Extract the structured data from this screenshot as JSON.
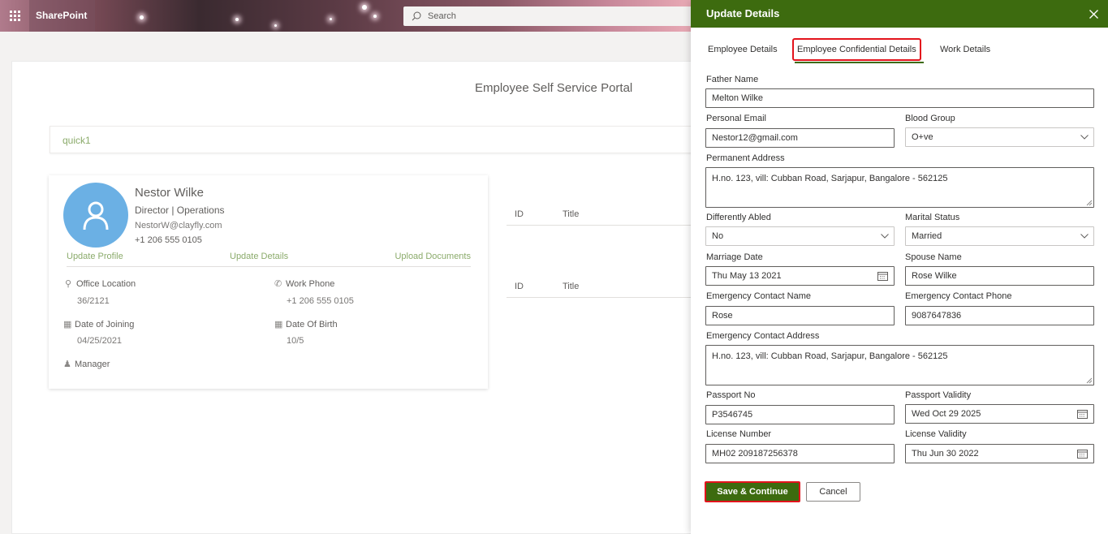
{
  "suite": {
    "brand": "SharePoint",
    "search_placeholder": "Search"
  },
  "page": {
    "title": "Employee Self Service Portal",
    "quick_links": "quick1"
  },
  "profile": {
    "name": "Nestor Wilke",
    "role": "Director | Operations",
    "email": "NestorW@clayfly.com",
    "phone": "+1 206 555 0105",
    "links": {
      "update_profile": "Update Profile",
      "update_details": "Update Details",
      "upload_documents": "Upload Documents"
    },
    "office_location_label": "Office Location",
    "office_location": "36/2121",
    "work_phone_label": "Work Phone",
    "work_phone": "+1 206 555 0105",
    "date_of_joining_label": "Date of Joining",
    "date_of_joining": "04/25/2021",
    "date_of_birth_label": "Date Of Birth",
    "date_of_birth": "10/5",
    "manager_label": "Manager"
  },
  "tables": [
    {
      "col_id": "ID",
      "col_title": "Title"
    },
    {
      "col_id": "ID",
      "col_title": "Title"
    }
  ],
  "panel": {
    "title": "Update Details",
    "tabs": [
      "Employee Details",
      "Employee Confidential Details",
      "Work Details"
    ],
    "active_tab": "Employee Confidential Details",
    "fields": {
      "father_name": {
        "label": "Father Name",
        "value": "Melton Wilke"
      },
      "personal_email": {
        "label": "Personal Email",
        "value": "Nestor12@gmail.com"
      },
      "blood_group": {
        "label": "Blood Group",
        "value": "O+ve"
      },
      "permanent_address": {
        "label": "Permanent Address",
        "value": "H.no. 123, vill:  Cubban Road, Sarjapur, Bangalore - 562125"
      },
      "differently_abled": {
        "label": "Differently Abled",
        "value": "No"
      },
      "marital_status": {
        "label": "Marital Status",
        "value": "Married"
      },
      "marriage_date": {
        "label": "Marriage Date",
        "value": "Thu May 13 2021"
      },
      "spouse_name": {
        "label": "Spouse Name",
        "value": "Rose Wilke"
      },
      "emergency_contact_name": {
        "label": "Emergency Contact Name",
        "value": "Rose"
      },
      "emergency_contact_phone": {
        "label": "Emergency Contact Phone",
        "value": "9087647836"
      },
      "emergency_contact_address": {
        "label": "Emergency Contact Address",
        "value": "H.no. 123, vill:  Cubban Road, Sarjapur, Bangalore - 562125"
      },
      "passport_no": {
        "label": "Passport No",
        "value": "P3546745"
      },
      "passport_validity": {
        "label": "Passport Validity",
        "value": "Wed Oct 29 2025"
      },
      "license_number": {
        "label": "License Number",
        "value": "MH02 209187256378"
      },
      "license_validity": {
        "label": "License Validity",
        "value": "Thu Jun 30 2022"
      }
    },
    "buttons": {
      "save": "Save & Continue",
      "cancel": "Cancel"
    }
  },
  "colors": {
    "accent": "#3d6b0f",
    "highlight": "#e3131c",
    "link": "#8bab6b",
    "avatar": "#6bb0e4"
  }
}
